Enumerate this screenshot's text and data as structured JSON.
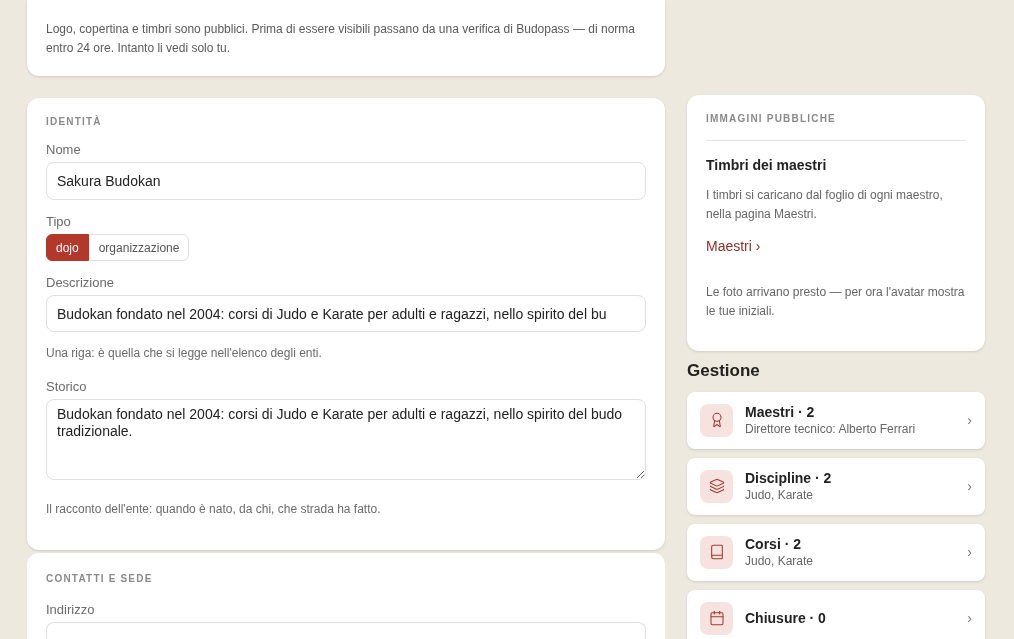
{
  "notice": {
    "text": "Logo, copertina e timbri sono pubblici. Prima di essere visibili passano da una verifica di Budopass — di norma entro 24 ore. Intanto li vedi solo tu."
  },
  "identity": {
    "heading": "IDENTITÀ",
    "name": {
      "label": "Nome",
      "value": "Sakura Budokan"
    },
    "type": {
      "label": "Tipo",
      "options": [
        {
          "label": "dojo",
          "selected": true
        },
        {
          "label": "organizzazione",
          "selected": false
        }
      ]
    },
    "description": {
      "label": "Descrizione",
      "value": "Budokan fondato nel 2004: corsi di Judo e Karate per adulti e ragazzi, nello spirito del bu",
      "hint": "Una riga: è quella che si legge nell'elenco degli enti."
    },
    "history": {
      "label": "Storico",
      "value": "Budokan fondato nel 2004: corsi di Judo e Karate per adulti e ragazzi, nello spirito del budo tradizionale.",
      "hint": "Il racconto dell'ente: quando è nato, da chi, che strada ha fatto."
    }
  },
  "contacts": {
    "heading": "CONTATTI E SEDE",
    "address": {
      "label": "Indirizzo"
    }
  },
  "public_images": {
    "heading": "IMMAGINI PUBBLICHE",
    "title": "Timbri dei maestri",
    "text": "I timbri si caricano dal foglio di ogni maestro, nella pagina Maestri.",
    "link": "Maestri ›",
    "note": "Le foto arrivano presto — per ora l'avatar mostra le tue iniziali."
  },
  "management": {
    "title": "Gestione",
    "items": [
      {
        "kind": "award",
        "title": "Maestri · 2",
        "subtitle": "Direttore tecnico: Alberto Ferrari",
        "chevron": "›"
      },
      {
        "kind": "layers",
        "title": "Discipline · 2",
        "subtitle": "Judo, Karate",
        "chevron": "›"
      },
      {
        "kind": "book",
        "title": "Corsi · 2",
        "subtitle": "Judo, Karate",
        "chevron": "›"
      },
      {
        "kind": "calendar",
        "title": "Chiusure · 0",
        "chevron": "›"
      }
    ]
  }
}
